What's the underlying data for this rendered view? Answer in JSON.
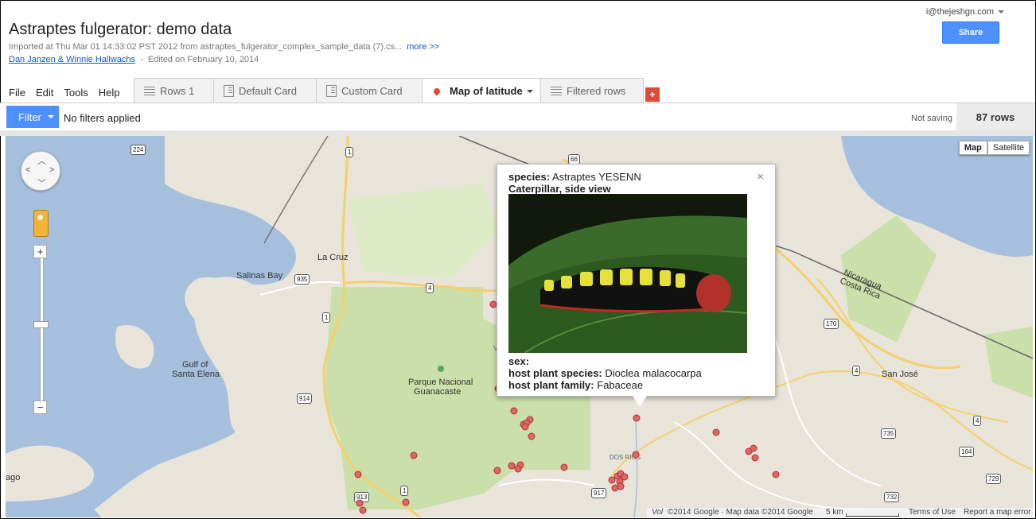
{
  "header": {
    "title": "Astraptes fulgerator: demo data",
    "imported": "Imported at Thu Mar 01 14:33:02 PST 2012 from astraptes_fulgerator_complex_sample_data (7).cs...",
    "more_link": "more >>",
    "authors": "Dan Janzen & Winnie Hallwachs",
    "edited": "Edited on February 10, 2014",
    "user_email": "i@thejeshgn.com",
    "share_label": "Share"
  },
  "menu": [
    "File",
    "Edit",
    "Tools",
    "Help"
  ],
  "tabs": [
    {
      "label": "Rows 1",
      "icon": "rows-icon"
    },
    {
      "label": "Default Card",
      "icon": "card-icon"
    },
    {
      "label": "Custom Card",
      "icon": "card-icon"
    },
    {
      "label": "Map of latitude",
      "icon": "map-pin-icon",
      "active": true
    },
    {
      "label": "Filtered rows",
      "icon": "rows-icon"
    }
  ],
  "add_tab_label": "+",
  "filter_bar": {
    "filter_label": "Filter",
    "status": "No filters applied",
    "saving": "Not saving",
    "row_count": "87 rows"
  },
  "map": {
    "map_type": {
      "map": "Map",
      "satellite": "Satellite"
    },
    "labels": {
      "salinas_bay": "Salinas Bay",
      "la_cruz": "La Cruz",
      "gulf_1": "Gulf of",
      "gulf_2": "Santa Elena",
      "park_1": "Parque Nacional",
      "park_2": "Guanacaste",
      "nicaragua": "Nicaragua",
      "costa_rica": "Costa Rica",
      "san_jose": "San José",
      "dos_rios": "DOS RIOS",
      "ago": "ago",
      "v": "V"
    },
    "route_shields": {
      "r224": "224",
      "r1a": "1",
      "r935": "935",
      "r4a": "4",
      "r1b": "1",
      "r914": "914",
      "r913": "913",
      "r1c": "1",
      "r917": "917",
      "r66": "66",
      "r170": "170",
      "r4b": "4",
      "r735": "735",
      "r164": "164",
      "r4c": "4",
      "r729": "729",
      "r732": "732"
    },
    "footer": {
      "vol": "Vol",
      "copyright": "©2014 Google · Map data ©2014 Google",
      "scale": "5 km",
      "terms": "Terms of Use",
      "report": "Report a map error"
    },
    "zoom_in": "+",
    "zoom_out": "−",
    "marker_color": "#e06666"
  },
  "popup": {
    "species_label": "species:",
    "species_value": "Astraptes YESENN",
    "photo_caption": "Caterpillar, side view",
    "sex_label": "sex:",
    "host_species_label": "host plant species:",
    "host_species_value": "Dioclea malacocarpa",
    "host_family_label": "host plant family:",
    "host_family_value": "Fabaceae",
    "close": "×"
  },
  "colors": {
    "accent": "#4d90fe",
    "add_tab": "#dd4b39",
    "water": "#a5bfdd",
    "park": "#cadfaa",
    "land": "#e8e4da",
    "road": "#f5d06a"
  }
}
